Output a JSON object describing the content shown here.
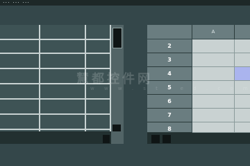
{
  "window": {
    "title": "... ... ..."
  },
  "left_table": {
    "rows": 8,
    "cols": 3
  },
  "sheet": {
    "columns": [
      "A",
      "",
      ""
    ],
    "rows": [
      "2",
      "3",
      "4",
      "5",
      "6",
      "7",
      "8"
    ],
    "selected_row_label": "4"
  },
  "watermark": {
    "text": "慧都控件网",
    "url": "w w w . s t e e d . c o m"
  },
  "colors": {
    "background": "#2f3f3f",
    "header": "#6a7d80",
    "cell": "#c9d2d2",
    "selected_cell": "#aab4ee"
  }
}
